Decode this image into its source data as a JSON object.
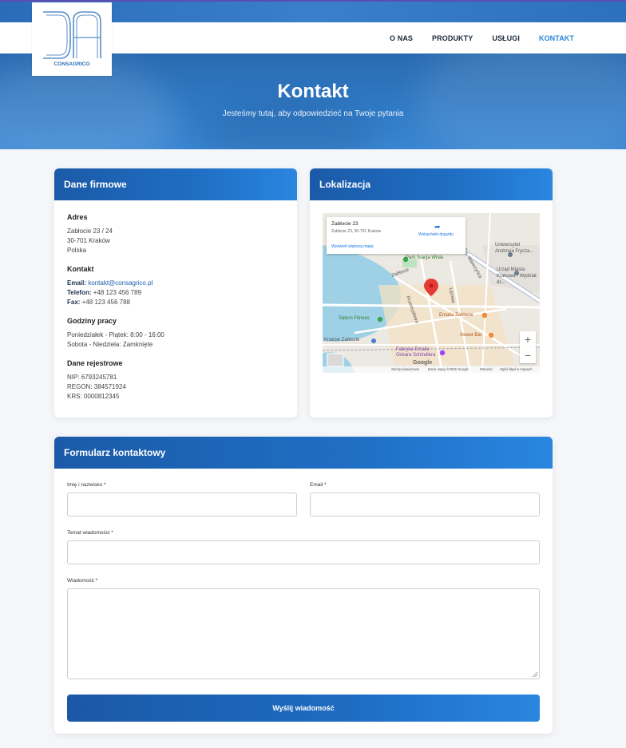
{
  "brand": {
    "logo_text": "CONSAGRICO"
  },
  "nav": {
    "items": [
      "O NAS",
      "PRODUKTY",
      "USŁUGI",
      "KONTAKT"
    ],
    "active": "KONTAKT"
  },
  "hero": {
    "title": "Kontakt",
    "subtitle": "Jesteśmy tutaj, aby odpowiedzieć na Twoje pytania"
  },
  "company": {
    "heading": "Dane firmowe",
    "address": {
      "title": "Adres",
      "lines": [
        "Zabłocie 23 / 24",
        "30-701 Kraków",
        "Polska"
      ]
    },
    "contact": {
      "title": "Kontakt",
      "email_label": "Email:",
      "email": "kontakt@consagrico.pl",
      "phone_label": "Telefon:",
      "phone": "+48 123 456 789",
      "fax_label": "Fax:",
      "fax": "+48 123 456 788"
    },
    "hours": {
      "title": "Godziny pracy",
      "lines": [
        "Poniedziałek - Piątek: 8:00 - 16:00",
        "Sobota - Niedziela: Zamknięte"
      ]
    },
    "registry": {
      "title": "Dane rejestrowe",
      "lines": [
        "NIP: 6793245781",
        "REGON: 384571924",
        "KRS: 0000812345"
      ]
    }
  },
  "location": {
    "heading": "Lokalizacja",
    "map_card": {
      "title": "Zabłocie 23",
      "address": "Zabłocie 23, 30-701 Kraków",
      "directions": "Wskazówki dojazdu",
      "bigger_map": "Wyświetl większą mapę"
    },
    "labels": {
      "park": "Park Stacja Wisła",
      "university": "Uniwersytet Andrzeja Frycza...",
      "office": "Urząd Miasta Krakowa - Wydział ds...",
      "saturn": "Saturn Fitness",
      "emalia": "Emalia Zabłocie",
      "street_zablocie": "Zabłocie",
      "street_przemyslowa": "Przemysłowa",
      "street_lipowa": "Lipowa",
      "street_sw": "Św. Wawrzyńca",
      "station": "Kraków Zabłocie",
      "schindler": "Fabryka Emalia Oskara Schindlera",
      "sweet_bar": "Sweet Bar",
      "google": "Google",
      "shortcuts": "Skróty klawiszowe",
      "map_data": "Dane mapy ©2025 Google",
      "terms": "Warunki",
      "report": "Zgłoś błąd w mapach"
    }
  },
  "form": {
    "heading": "Formularz kontaktowy",
    "name_label": "Imię i nazwisko *",
    "email_label": "Email *",
    "subject_label": "Temat wiadomości *",
    "message_label": "Wiadomość *",
    "submit_label": "Wyślij wiadomość"
  },
  "colors": {
    "primary": "#1f6fc4",
    "accent": "#2a86d8",
    "pin": "#e53935"
  }
}
